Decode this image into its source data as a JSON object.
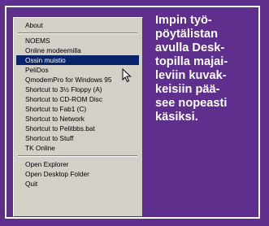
{
  "menu": {
    "items": [
      {
        "label": "About"
      },
      {
        "label": "NOEMS"
      },
      {
        "label": "Online modeemilla"
      },
      {
        "label": "Ossin muistio",
        "selected": true
      },
      {
        "label": "PeliDos"
      },
      {
        "label": "QmodemPro for Windows 95"
      },
      {
        "label": "Shortcut to 3½ Floppy (A)"
      },
      {
        "label": "Shortcut to CD-ROM Disc"
      },
      {
        "label": "Shortcut to Fab1 (C)"
      },
      {
        "label": "Shortcut to Network"
      },
      {
        "label": "Shortcut to Pelitbbs.bat"
      },
      {
        "label": "Shortcut to Stuff"
      },
      {
        "label": "TK Online"
      },
      {
        "label": "Open Explorer"
      },
      {
        "label": "Open Desktop Folder"
      },
      {
        "label": "Quit"
      }
    ]
  },
  "caption": {
    "lines": [
      "Impin työ-",
      "pöytälistan",
      "avulla Desk-",
      "topilla majai-",
      "leviin kuvak-",
      "keisiin pää-",
      "see nopeasti",
      "käsiksi."
    ]
  },
  "colors": {
    "background": "#5e2f8c",
    "highlight": "#0a246a",
    "menu": "#d4d0c8"
  }
}
